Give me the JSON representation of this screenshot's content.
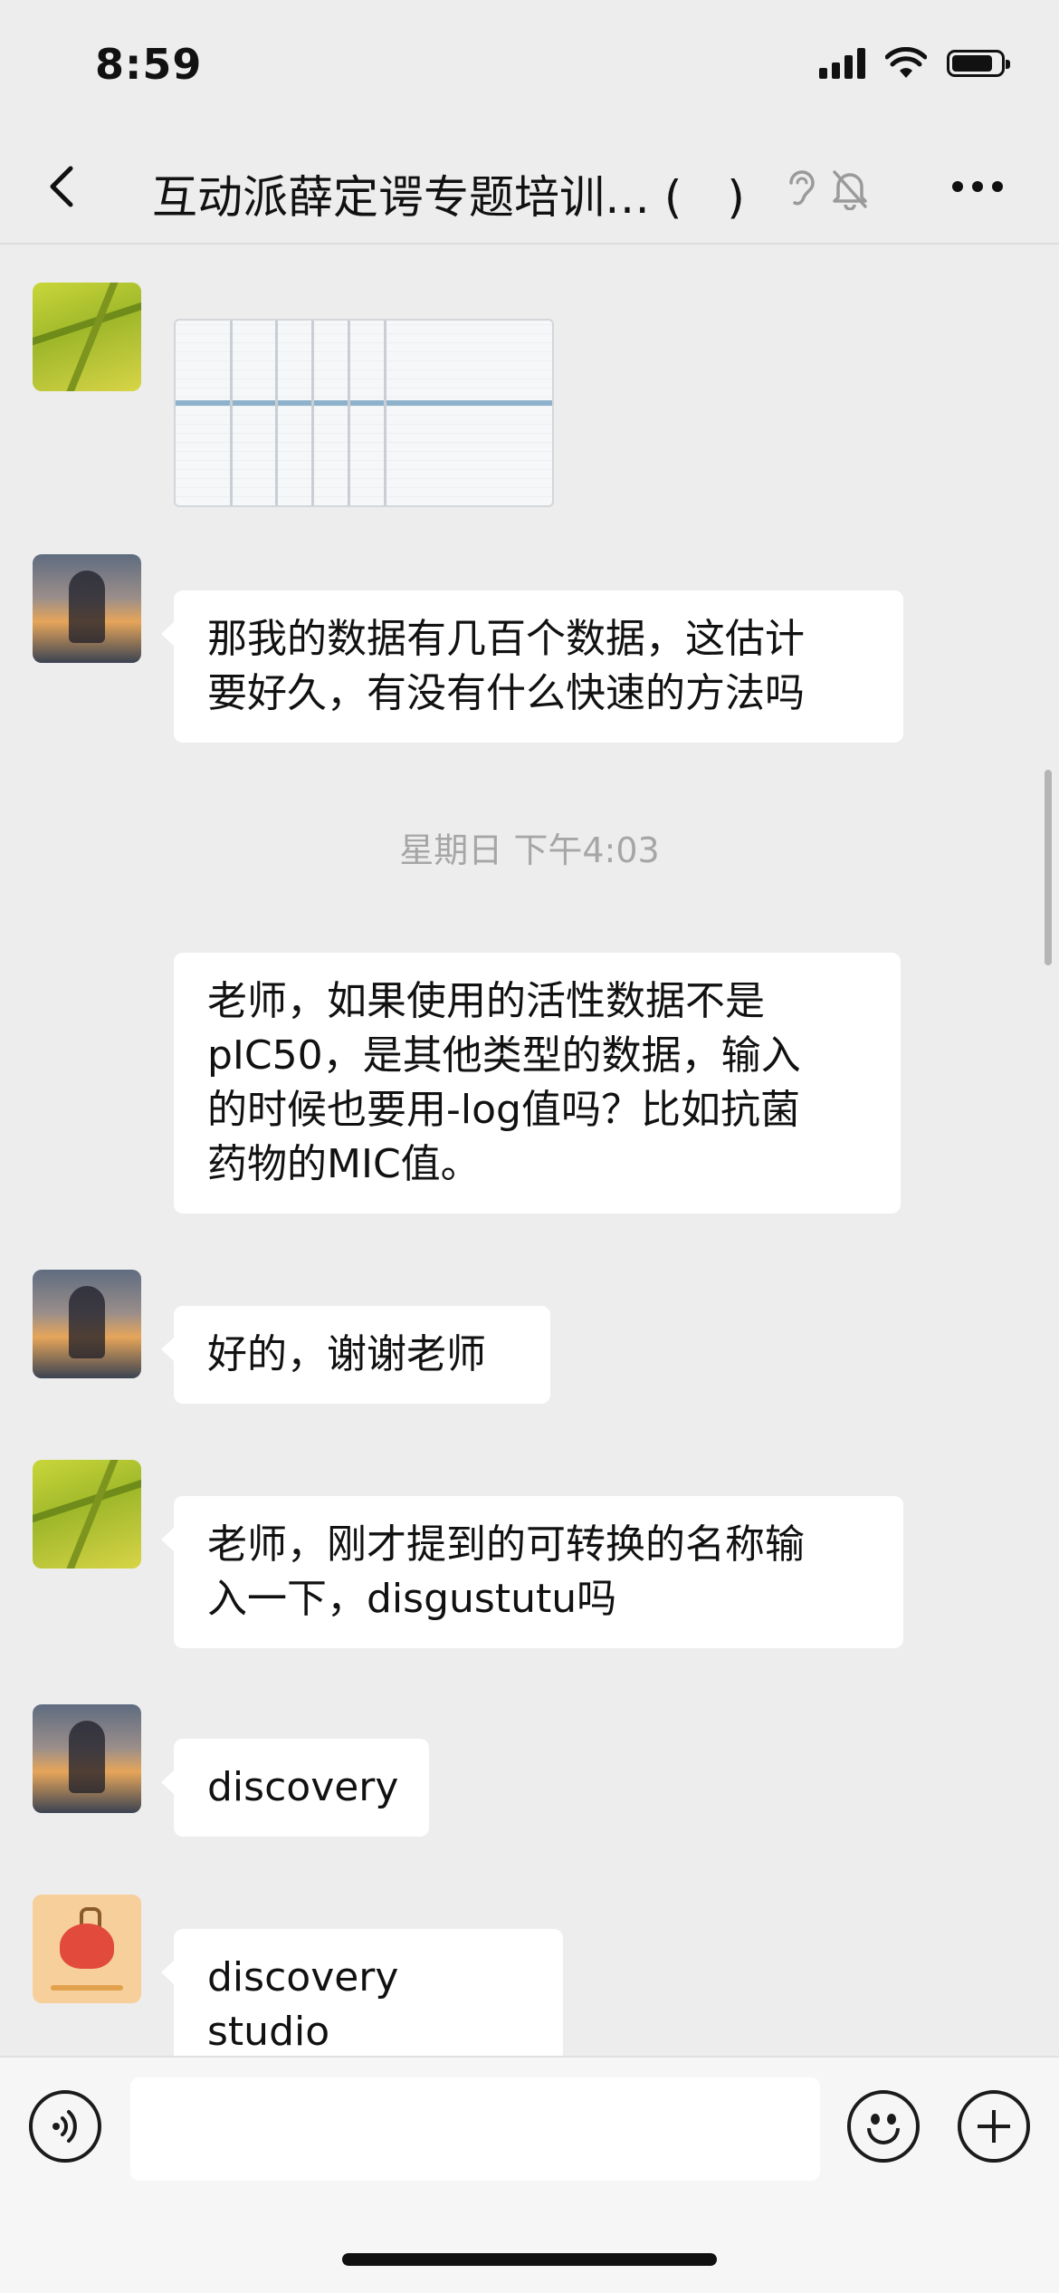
{
  "status_bar": {
    "time": "8:59"
  },
  "header": {
    "title": "互动派薛定谔专题培训… (",
    "title_suffix": ")"
  },
  "messages": [
    {
      "type": "image",
      "sender": "field-avatar"
    },
    {
      "type": "text",
      "sender": "sunset-avatar",
      "text_lines": [
        "那我的数据有几百个数据，这估计",
        "要好久，有没有什么快速的方法吗"
      ]
    },
    {
      "type": "timestamp",
      "text": "星期日 下午4:03"
    },
    {
      "type": "text",
      "sender": "none",
      "text_lines": [
        "老师，如果使用的活性数据不是",
        "pIC50，是其他类型的数据，输入",
        "的时候也要用-log值吗？比如抗菌",
        "药物的MIC值。"
      ]
    },
    {
      "type": "text",
      "sender": "sunset-avatar",
      "text_lines": [
        "好的，谢谢老师"
      ]
    },
    {
      "type": "text",
      "sender": "field-avatar",
      "text_lines": [
        "老师，刚才提到的可转换的名称输",
        "入一下，disgustutu吗"
      ]
    },
    {
      "type": "text",
      "sender": "sunset-avatar",
      "text_lines": [
        "discovery"
      ]
    },
    {
      "type": "text",
      "sender": "cartoon-avatar",
      "text_lines": [
        "discovery studio"
      ]
    }
  ],
  "input_bar": {
    "placeholder": ""
  }
}
